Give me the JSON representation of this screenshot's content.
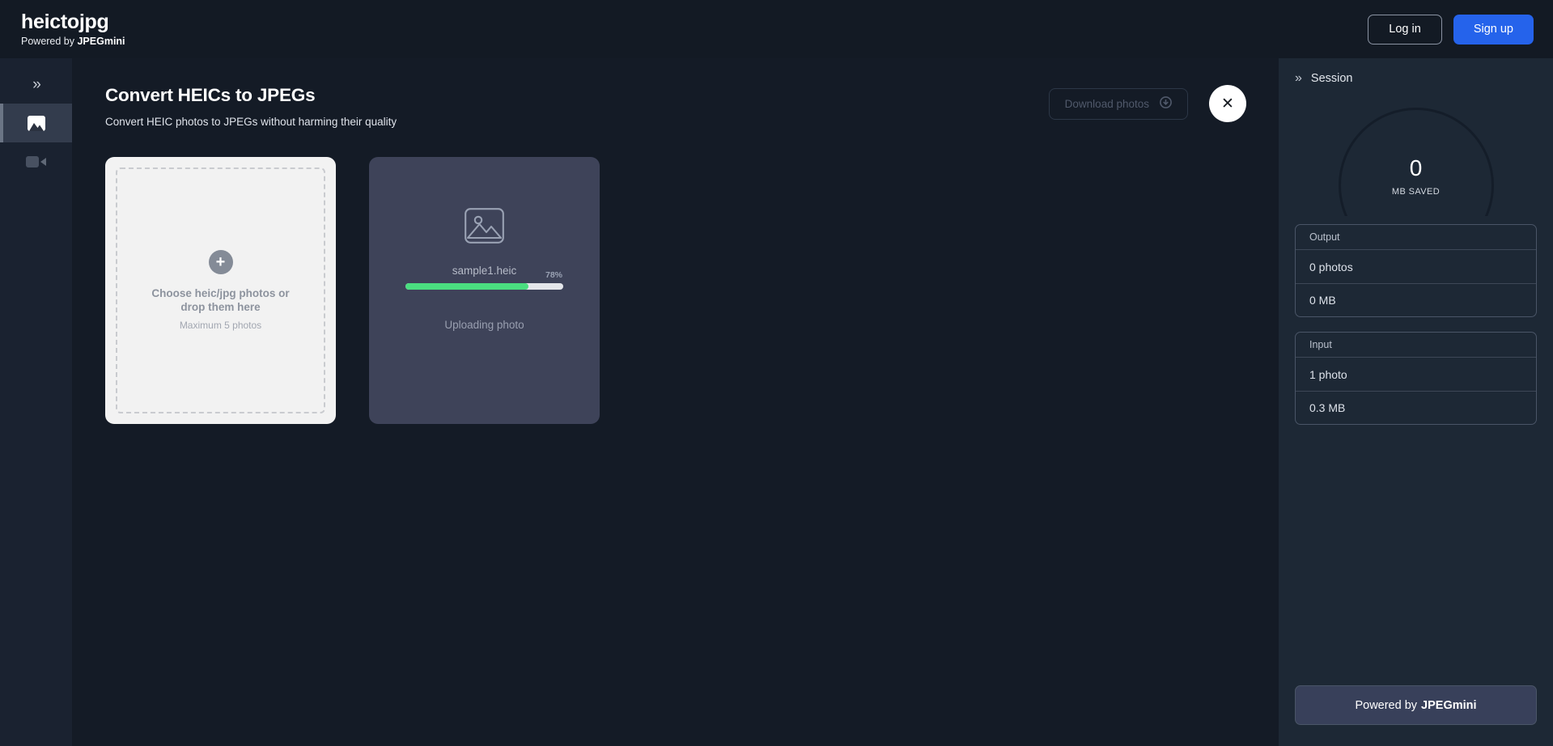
{
  "header": {
    "brand_title": "heictojpg",
    "brand_powered_prefix": "Powered by ",
    "brand_powered_name": "JPEGmini",
    "login_label": "Log in",
    "signup_label": "Sign up",
    "signup_color": "#2563eb"
  },
  "sidebar": {
    "items": [
      {
        "name": "expand-chevron",
        "icon": "chevron-double-right-icon",
        "label": "»",
        "active": false
      },
      {
        "name": "photos",
        "icon": "image-icon",
        "label": "",
        "active": true
      },
      {
        "name": "videos",
        "icon": "video-camera-icon",
        "label": "",
        "active": false
      }
    ]
  },
  "main": {
    "page_title": "Convert HEICs to JPEGs",
    "page_subtitle": "Convert HEIC photos to JPEGs without harming their quality",
    "download_label": "Download photos",
    "download_enabled": false,
    "close_label": "✕",
    "dropzone": {
      "plus_glyph": "+",
      "title": "Choose heic/jpg photos or drop them here",
      "note": "Maximum 5 photos"
    },
    "upload_card": {
      "file_name": "sample1.heic",
      "progress_percent": 78,
      "progress_label": "78%",
      "status": "Uploading photo",
      "progress_color": "#4ade80"
    }
  },
  "session": {
    "title": "Session",
    "gauge_value": "0",
    "gauge_label": "MB SAVED",
    "groups": [
      {
        "heading": "Output",
        "rows": [
          "0 photos",
          "0 MB"
        ]
      },
      {
        "heading": "Input",
        "rows": [
          "1 photo",
          "0.3 MB"
        ]
      }
    ],
    "powered_prefix": "Powered by ",
    "powered_name": "JPEGmini"
  }
}
